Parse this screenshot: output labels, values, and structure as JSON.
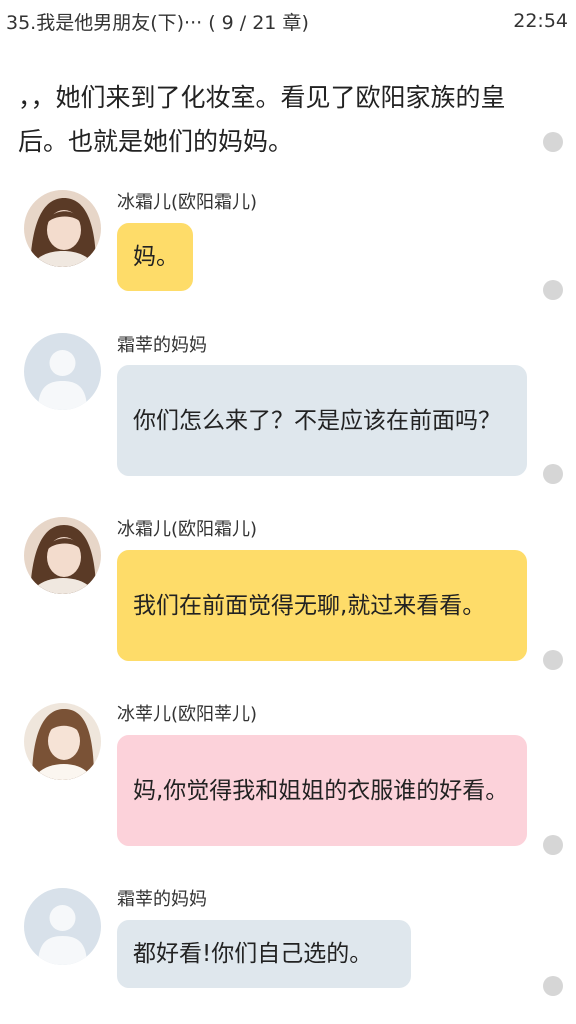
{
  "status": {
    "chapter_title": "35.我是他男朋友(下)··· ( 9 / 21 章)",
    "time": "22:54"
  },
  "narration": "，，她们来到了化妆室。看见了欧阳家族的皇后。也就是她们的妈妈。",
  "messages": [
    {
      "sender": "冰霜儿(欧阳霜儿)",
      "text": "妈。",
      "avatar": "girl-avatar-1",
      "color": "#fedc69"
    },
    {
      "sender": "霜莘的妈妈",
      "text": "你们怎么来了？不是应该在前面吗？",
      "avatar": "default-avatar",
      "color": "#dfe7ed"
    },
    {
      "sender": "冰霜儿(欧阳霜儿)",
      "text": "我们在前面觉得无聊,就过来看看。",
      "avatar": "girl-avatar-1",
      "color": "#fedc69"
    },
    {
      "sender": "冰莘儿(欧阳莘儿)",
      "text": "妈,你觉得我和姐姐的衣服谁的好看。",
      "avatar": "girl-avatar-2",
      "color": "#fcd2da"
    },
    {
      "sender": "霜莘的妈妈",
      "text": "都好看!你们自己选的。",
      "avatar": "default-avatar",
      "color": "#dfe7ed"
    }
  ]
}
